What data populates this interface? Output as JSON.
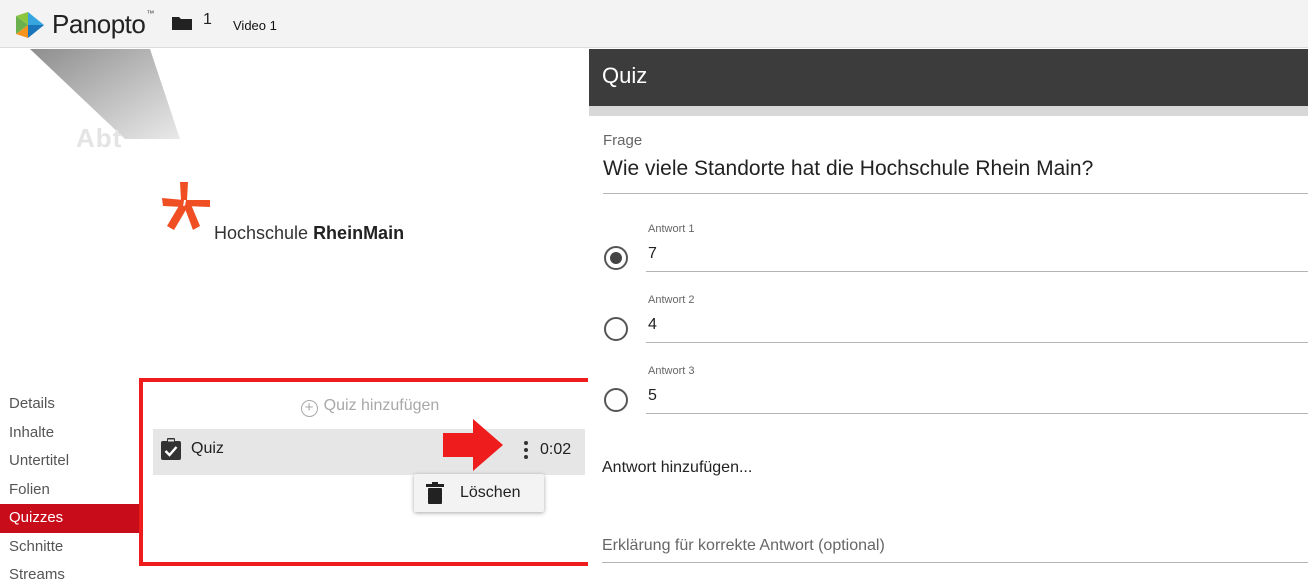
{
  "app": {
    "brand": "Panopto",
    "trademark": "™",
    "breadcrumb_separator": "1",
    "video_title": "Video 1"
  },
  "preview": {
    "faded_text": "Abt",
    "institution_regular": "Hochschule ",
    "institution_bold": "RheinMain"
  },
  "nav": {
    "items": [
      "Details",
      "Inhalte",
      "Untertitel",
      "Folien",
      "Quizzes",
      "Schnitte",
      "Streams"
    ],
    "active": "Quizzes"
  },
  "quiz_list": {
    "add_label": "Quiz hinzufügen",
    "items": [
      {
        "label": "Quiz",
        "time": "0:02"
      }
    ],
    "context_menu": {
      "delete_label": "Löschen"
    }
  },
  "editor": {
    "title": "Quiz",
    "question_label": "Frage",
    "question_text": "Wie viele Standorte hat die Hochschule Rhein Main?",
    "answers": [
      {
        "label": "Antwort 1",
        "value": "7",
        "selected": true
      },
      {
        "label": "Antwort 2",
        "value": "4",
        "selected": false
      },
      {
        "label": "Antwort 3",
        "value": "5",
        "selected": false
      }
    ],
    "add_answer_label": "Antwort hinzufügen...",
    "explanation_placeholder": "Erklärung für korrekte Antwort (optional)"
  },
  "colors": {
    "accent_red": "#c80c1a",
    "highlight_border": "#ee1c1c",
    "header_dark": "#3c3c3c",
    "logo_orange": "#f04e23"
  },
  "icons": {
    "logo": "panopto-logo-icon",
    "folder": "folder-icon",
    "add": "plus-circle-icon",
    "quiz": "clipboard-check-icon",
    "more": "more-vertical-icon",
    "annotation": "red-arrow-icon",
    "delete": "trash-icon",
    "radio_on": "radio-checked-icon",
    "radio_off": "radio-unchecked-icon"
  }
}
